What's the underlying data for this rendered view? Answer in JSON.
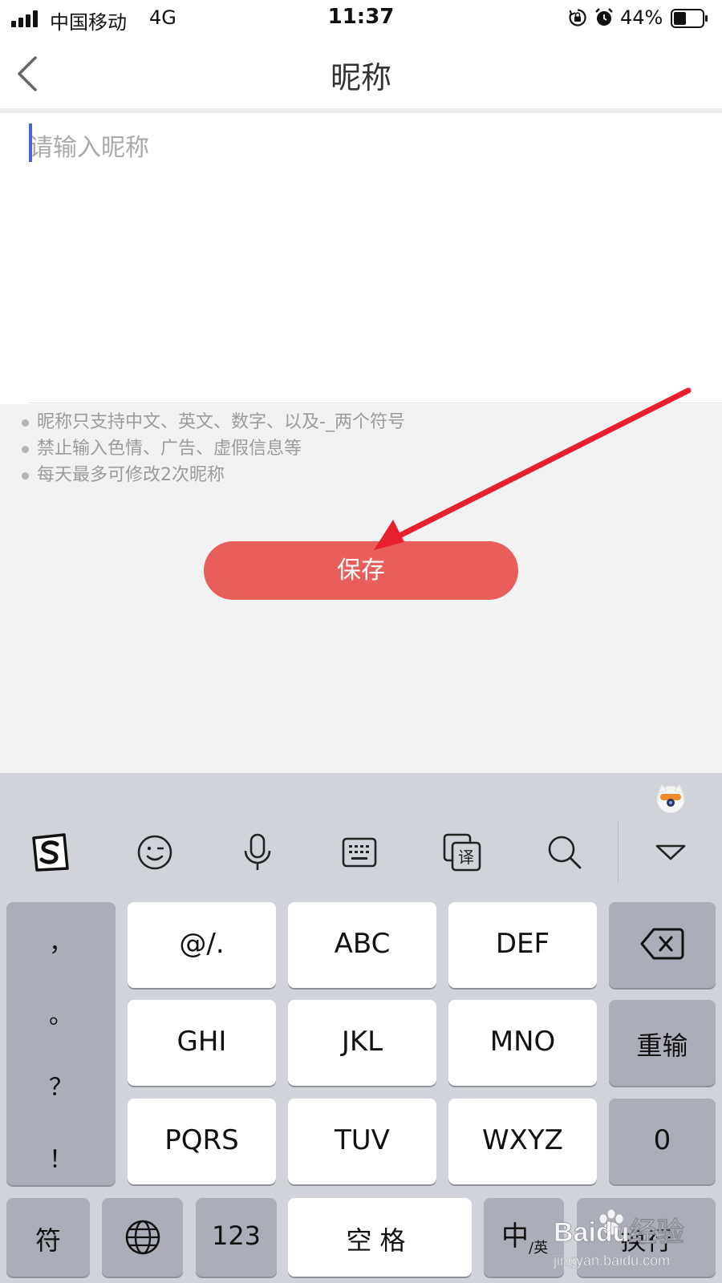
{
  "status_bar": {
    "carrier": "中国移动",
    "network": "4G",
    "time": "11:37",
    "battery_percent": "44%",
    "battery_level": 0.44,
    "icons": [
      "signal-icon",
      "rotation-lock-icon",
      "alarm-icon",
      "battery-icon"
    ]
  },
  "nav": {
    "title": "昵称",
    "back_icon": "chevron-left-icon"
  },
  "nickname_input": {
    "value": "",
    "placeholder": "请输入昵称"
  },
  "rules": [
    "昵称只支持中文、英文、数字、以及-_两个符号",
    "禁止输入色情、广告、虚假信息等",
    "每天最多可修改2次昵称"
  ],
  "save_button": {
    "label": "保存"
  },
  "colors": {
    "save_button": "#e85e5b",
    "annotation_arrow": "#e8202e",
    "caret": "#4a63d8",
    "keyboard_bg": "#d1d3db"
  },
  "keyboard": {
    "toolbar": [
      "sogou-logo-icon",
      "emoji-icon",
      "microphone-icon",
      "keyboard-icon",
      "translate-icon",
      "search-icon",
      "hide-keyboard-icon"
    ],
    "punctuation": [
      "，",
      "。",
      "？",
      "！"
    ],
    "letter_keys": [
      "@/.",
      "ABC",
      "DEF",
      "GHI",
      "JKL",
      "MNO",
      "PQRS",
      "TUV",
      "WXYZ"
    ],
    "backspace_icon": "backspace-icon",
    "reset_label": "重输",
    "zero_label": "0",
    "bottom_row": {
      "symbols_label": "符",
      "globe_icon": "globe-icon",
      "numbers_label": "123",
      "space_label": "空格",
      "lang_main": "中",
      "lang_sub": "/英",
      "enter_label": "换行"
    }
  },
  "watermark": {
    "text_main": "Baidu经验",
    "text_sub": "jingyan.baidu.com"
  }
}
